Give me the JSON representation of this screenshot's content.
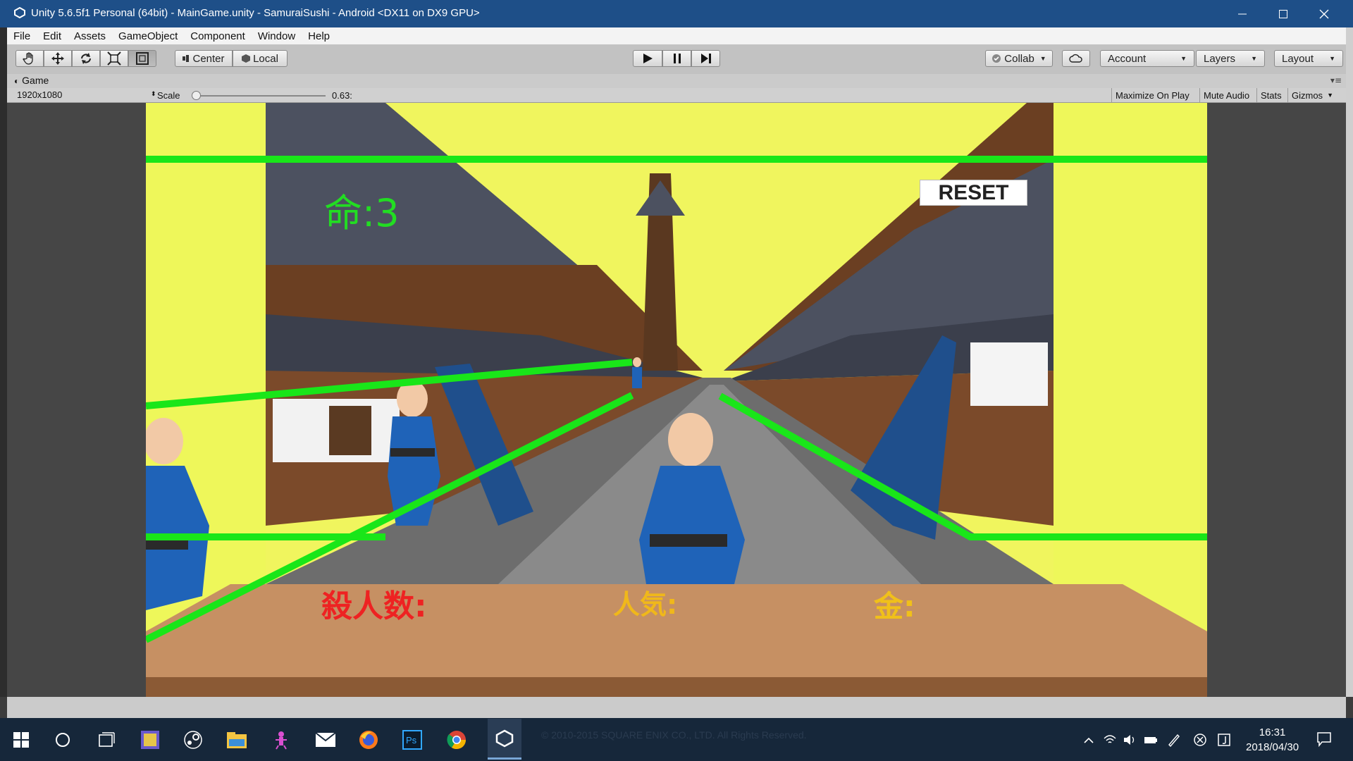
{
  "window": {
    "title": "Unity 5.6.5f1 Personal (64bit) - MainGame.unity - SamuraiSushi - Android <DX11 on DX9 GPU>",
    "controls": [
      "minimize",
      "maximize",
      "close"
    ]
  },
  "menu": [
    "File",
    "Edit",
    "Assets",
    "GameObject",
    "Component",
    "Window",
    "Help"
  ],
  "toolbar": {
    "transform_tools": [
      "hand-tool",
      "move-tool",
      "rotate-tool",
      "scale-tool",
      "rect-tool"
    ],
    "pivot_label": "Center",
    "space_label": "Local",
    "play_controls": [
      "play",
      "pause",
      "step"
    ],
    "collab_label": "Collab",
    "account_label": "Account",
    "layers_label": "Layers",
    "layout_label": "Layout"
  },
  "game_view": {
    "tab_label": "Game",
    "resolution": "1920x1080",
    "scale_label": "Scale",
    "scale_value": "0.63:",
    "scale_fraction": 0.03,
    "buttons": [
      "Maximize On Play",
      "Mute Audio",
      "Stats",
      "Gizmos"
    ]
  },
  "hud": {
    "lives": "命:3",
    "kills_label": "殺人数:",
    "popularity_label": "人気:",
    "money_label": "金:",
    "reset_label": "RESET"
  },
  "colors": {
    "game_background": "#eef75a",
    "slash_lines": "#19e619",
    "lives_text": "#22dd22",
    "kills_text": "#ee2222",
    "popularity_text": "#f0b81a",
    "money_text": "#f0c01a",
    "counter": "#c69063",
    "title_bar": "#1e4f88"
  },
  "taskbar": {
    "watermark": "© 2010-2015 SQUARE ENIX CO., LTD. All Rights Reserved.",
    "apps": [
      "start-icon",
      "search-circle-icon",
      "task-view-icon",
      "photo-app-icon",
      "steam-icon",
      "file-explorer-icon",
      "game-app-icon",
      "mail-icon",
      "firefox-icon",
      "photoshop-icon",
      "chrome-icon",
      "unity-icon"
    ],
    "time": "16:31",
    "date": "2018/04/30"
  }
}
